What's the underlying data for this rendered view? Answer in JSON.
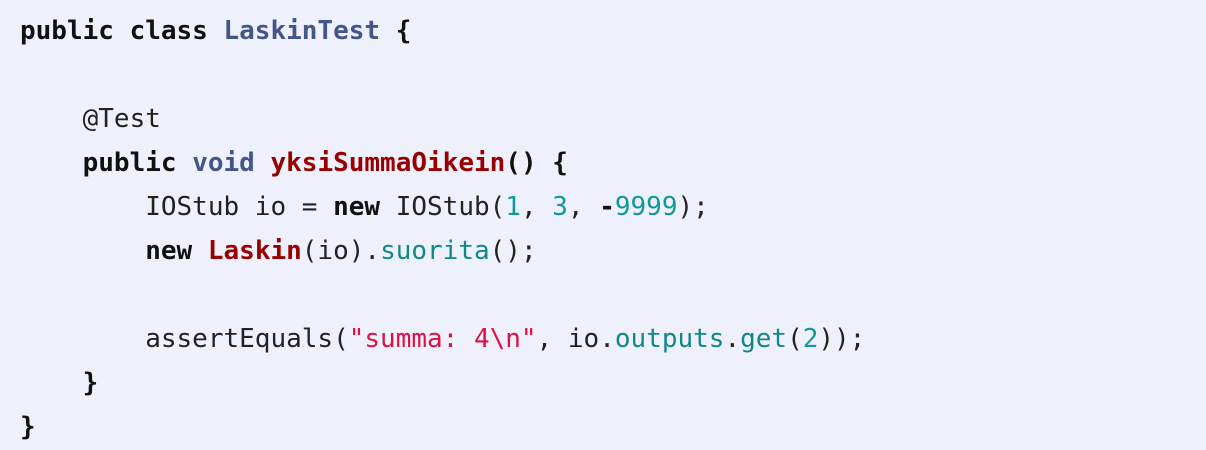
{
  "code": {
    "lines": [
      [
        {
          "t": "public class ",
          "c": "kw"
        },
        {
          "t": "LaskinTest",
          "c": "type"
        },
        {
          "t": " {",
          "c": "kw"
        }
      ],
      [],
      [
        {
          "t": "    @Test",
          "c": "plain"
        }
      ],
      [
        {
          "t": "    ",
          "c": "plain"
        },
        {
          "t": "public",
          "c": "kw"
        },
        {
          "t": " ",
          "c": "plain"
        },
        {
          "t": "void",
          "c": "type"
        },
        {
          "t": " ",
          "c": "plain"
        },
        {
          "t": "yksiSummaOikein",
          "c": "fn"
        },
        {
          "t": "() {",
          "c": "kw"
        }
      ],
      [
        {
          "t": "        IOStub io = ",
          "c": "plain"
        },
        {
          "t": "new",
          "c": "kw"
        },
        {
          "t": " IOStub(",
          "c": "plain"
        },
        {
          "t": "1",
          "c": "num"
        },
        {
          "t": ", ",
          "c": "plain"
        },
        {
          "t": "3",
          "c": "num"
        },
        {
          "t": ", ",
          "c": "plain"
        },
        {
          "t": "-",
          "c": "kw"
        },
        {
          "t": "9999",
          "c": "num"
        },
        {
          "t": ");",
          "c": "plain"
        }
      ],
      [
        {
          "t": "        ",
          "c": "plain"
        },
        {
          "t": "new",
          "c": "kw"
        },
        {
          "t": " ",
          "c": "plain"
        },
        {
          "t": "Laskin",
          "c": "fn"
        },
        {
          "t": "(io).",
          "c": "plain"
        },
        {
          "t": "suorita",
          "c": "member"
        },
        {
          "t": "();",
          "c": "plain"
        }
      ],
      [],
      [
        {
          "t": "        assertEquals(",
          "c": "plain"
        },
        {
          "t": "\"summa: 4\\n\"",
          "c": "str"
        },
        {
          "t": ", io.",
          "c": "plain"
        },
        {
          "t": "outputs",
          "c": "member"
        },
        {
          "t": ".",
          "c": "plain"
        },
        {
          "t": "get",
          "c": "member"
        },
        {
          "t": "(",
          "c": "plain"
        },
        {
          "t": "2",
          "c": "num"
        },
        {
          "t": "));",
          "c": "plain"
        }
      ],
      [
        {
          "t": "    }",
          "c": "kw"
        }
      ],
      [
        {
          "t": "}",
          "c": "kw"
        }
      ]
    ]
  },
  "colors": {
    "background": "#eef0fb",
    "keyword": "#111111",
    "type": "#445588",
    "function": "#990000",
    "number": "#119999",
    "string": "#dd1144",
    "member": "#118888"
  }
}
